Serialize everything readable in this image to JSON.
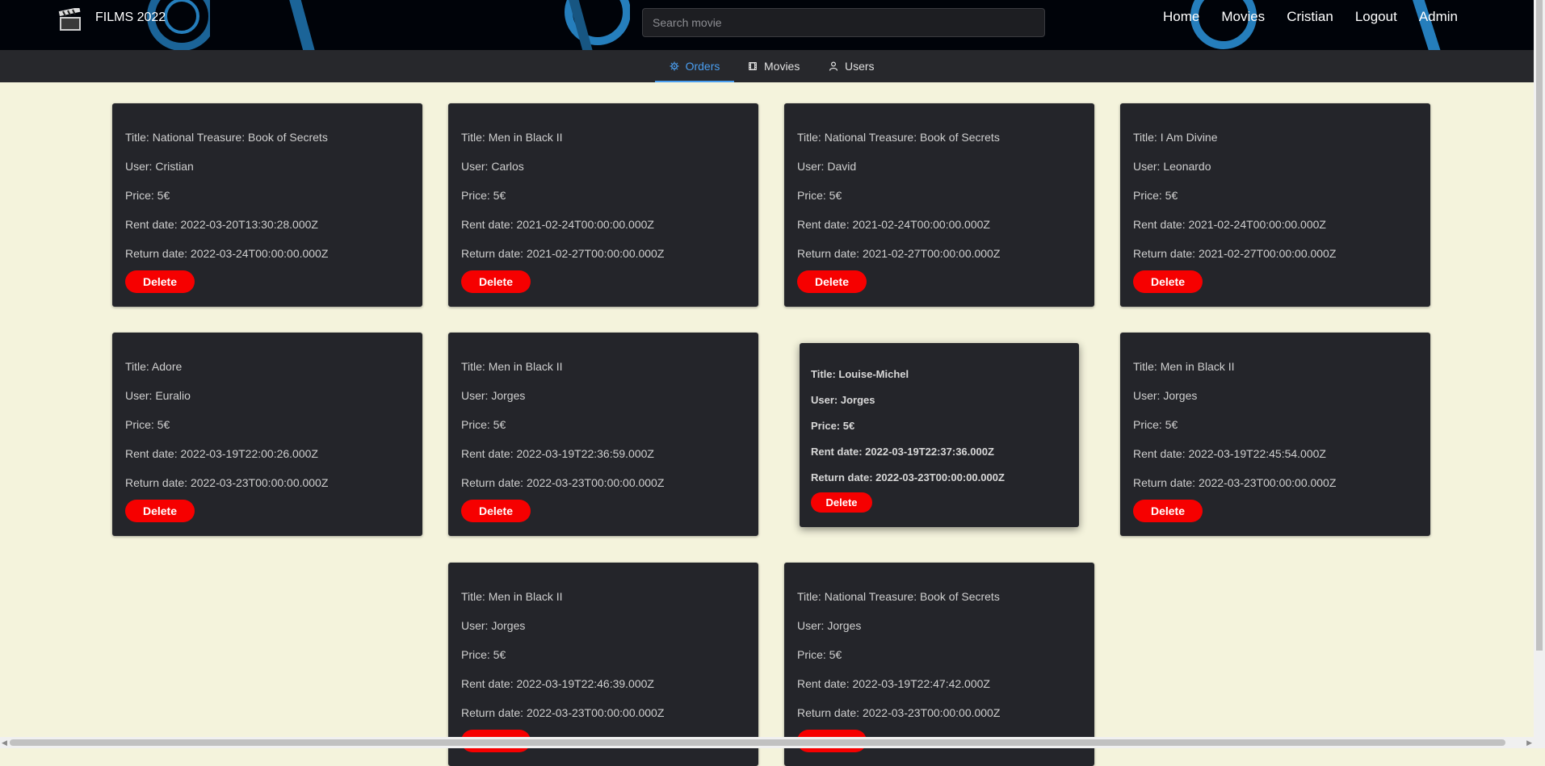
{
  "header": {
    "brand": "FILMS 2022",
    "search_placeholder": "Search movie",
    "nav": [
      "Home",
      "Movies",
      "Cristian",
      "Logout",
      "Admin"
    ]
  },
  "tabs": [
    {
      "label": "Orders",
      "icon": "gear-icon",
      "active": true
    },
    {
      "label": "Movies",
      "icon": "film-icon",
      "active": false
    },
    {
      "label": "Users",
      "icon": "user-icon",
      "active": false
    }
  ],
  "orders": [
    {
      "title": "Title: National Treasure: Book of Secrets",
      "user": "User: Cristian",
      "price": "Price: 5€",
      "rent": "Rent date: 2022-03-20T13:30:28.000Z",
      "ret": "Return date: 2022-03-24T00:00:00.000Z",
      "action": "Delete"
    },
    {
      "title": "Title: Men in Black II",
      "user": "User: Carlos",
      "price": "Price: 5€",
      "rent": "Rent date: 2021-02-24T00:00:00.000Z",
      "ret": "Return date: 2021-02-27T00:00:00.000Z",
      "action": "Delete"
    },
    {
      "title": "Title: National Treasure: Book of Secrets",
      "user": "User: David",
      "price": "Price: 5€",
      "rent": "Rent date: 2021-02-24T00:00:00.000Z",
      "ret": "Return date: 2021-02-27T00:00:00.000Z",
      "action": "Delete"
    },
    {
      "title": "Title: I Am Divine",
      "user": "User: Leonardo",
      "price": "Price: 5€",
      "rent": "Rent date: 2021-02-24T00:00:00.000Z",
      "ret": "Return date: 2021-02-27T00:00:00.000Z",
      "action": "Delete"
    },
    {
      "title": "Title: Adore",
      "user": "User: Euralio",
      "price": "Price: 5€",
      "rent": "Rent date: 2022-03-19T22:00:26.000Z",
      "ret": "Return date: 2022-03-23T00:00:00.000Z",
      "action": "Delete"
    },
    {
      "title": "Title: Men in Black II",
      "user": "User: Jorges",
      "price": "Price: 5€",
      "rent": "Rent date: 2022-03-19T22:36:59.000Z",
      "ret": "Return date: 2022-03-23T00:00:00.000Z",
      "action": "Delete"
    },
    {
      "title": "Title: Louise-Michel",
      "user": "User: Jorges",
      "price": "Price: 5€",
      "rent": "Rent date: 2022-03-19T22:37:36.000Z",
      "ret": "Return date: 2022-03-23T00:00:00.000Z",
      "action": "Delete"
    },
    {
      "title": "Title: Men in Black II",
      "user": "User: Jorges",
      "price": "Price: 5€",
      "rent": "Rent date: 2022-03-19T22:45:54.000Z",
      "ret": "Return date: 2022-03-23T00:00:00.000Z",
      "action": "Delete"
    },
    {
      "title": "Title: Men in Black II",
      "user": "User: Jorges",
      "price": "Price: 5€",
      "rent": "Rent date: 2022-03-19T22:46:39.000Z",
      "ret": "Return date: 2022-03-23T00:00:00.000Z",
      "action": "Delete"
    },
    {
      "title": "Title: National Treasure: Book of Secrets",
      "user": "User: Jorges",
      "price": "Price: 5€",
      "rent": "Rent date: 2022-03-19T22:47:42.000Z",
      "ret": "Return date: 2022-03-23T00:00:00.000Z",
      "action": "Delete"
    }
  ],
  "colors": {
    "accent": "#4a9ef0",
    "delete": "#f60000",
    "card": "#24252a",
    "page_bg": "#f4f3dc"
  }
}
